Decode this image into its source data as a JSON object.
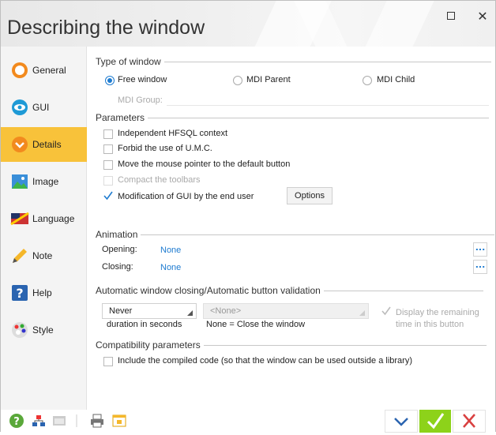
{
  "window": {
    "title": "Describing the window",
    "maximize_icon": "maximize-icon",
    "close_icon": "close-icon"
  },
  "sidebar": {
    "items": [
      {
        "label": "General",
        "icon": "general-icon",
        "active": false
      },
      {
        "label": "GUI",
        "icon": "gui-eye-icon",
        "active": false
      },
      {
        "label": "Details",
        "icon": "details-icon",
        "active": true
      },
      {
        "label": "Image",
        "icon": "image-icon",
        "active": false
      },
      {
        "label": "Language",
        "icon": "language-icon",
        "active": false
      },
      {
        "label": "Note",
        "icon": "note-pencil-icon",
        "active": false
      },
      {
        "label": "Help",
        "icon": "help-icon",
        "active": false
      },
      {
        "label": "Style",
        "icon": "style-palette-icon",
        "active": false
      }
    ],
    "active_color": "#f8c23a"
  },
  "type_of_window": {
    "heading": "Type of window",
    "options": [
      "Free window",
      "MDI Parent",
      "MDI Child"
    ],
    "selected": "Free window",
    "mdi_group_label": "MDI Group:"
  },
  "parameters": {
    "heading": "Parameters",
    "items": [
      {
        "label": "Independent HFSQL context",
        "checked": false,
        "enabled": true
      },
      {
        "label": "Forbid the use of U.M.C.",
        "checked": false,
        "enabled": true
      },
      {
        "label": "Move the mouse pointer to the default button",
        "checked": false,
        "enabled": true
      },
      {
        "label": "Compact the toolbars",
        "checked": false,
        "enabled": false
      },
      {
        "label": "Modification of GUI by the end user",
        "checked": true,
        "enabled": true
      }
    ],
    "options_button": "Options"
  },
  "animation": {
    "heading": "Animation",
    "opening_label": "Opening:",
    "opening_value": "None",
    "closing_label": "Closing:",
    "closing_value": "None",
    "more_button": "..."
  },
  "auto_close": {
    "heading": "Automatic window closing/Automatic button validation",
    "duration_value": "Never",
    "duration_caption": "duration in seconds",
    "button_value": "<None>",
    "button_caption": "None = Close the window",
    "display_remaining_line1": "Display the remaining",
    "display_remaining_line2": "time in this button",
    "display_remaining_checked": true
  },
  "compatibility": {
    "heading": "Compatibility parameters",
    "item_label": "Include the compiled code (so that the window can be used outside a library)",
    "checked": false
  },
  "bottom": {
    "icons": [
      "help-icon",
      "tree-icon",
      "window-icon",
      "print-icon",
      "new-window-icon"
    ],
    "ok_icon": "ok-check-icon",
    "cancel_icon": "cancel-x-icon",
    "dropdown_icon": "chevron-down-icon",
    "ok_color": "#8dd21a"
  },
  "accent_color": "#1e7bd0"
}
